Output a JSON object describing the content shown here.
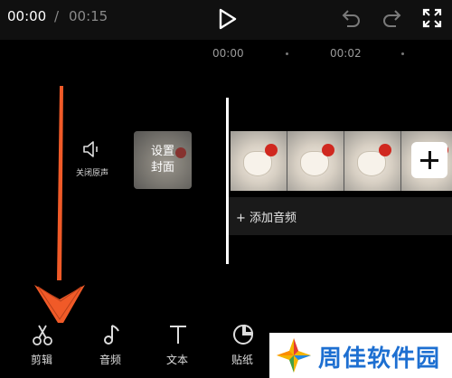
{
  "player": {
    "current_time": "00:00",
    "separator": "/",
    "total_time": "00:15"
  },
  "ruler": {
    "labels": [
      "00:00",
      "00:02"
    ]
  },
  "left_controls": {
    "mute_label": "关闭原声",
    "cover_label_line1": "设置",
    "cover_label_line2": "封面"
  },
  "timeline": {
    "add_audio_label": "+ 添加音频"
  },
  "toolbar": {
    "items": [
      {
        "label": "剪辑",
        "icon": "scissors-icon"
      },
      {
        "label": "音频",
        "icon": "music-note-icon"
      },
      {
        "label": "文本",
        "icon": "text-icon"
      },
      {
        "label": "贴纸",
        "icon": "sticker-icon"
      }
    ]
  },
  "watermark": {
    "text": "周佳软件园"
  },
  "colors": {
    "arrow": "#f05a28",
    "accent_blue": "#1d6fd1"
  }
}
